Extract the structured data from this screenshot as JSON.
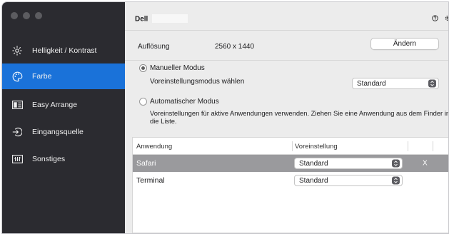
{
  "sidebar": {
    "items": [
      {
        "label": "Helligkeit / Kontrast",
        "icon": "brightness-icon",
        "active": false
      },
      {
        "label": "Farbe",
        "icon": "color-palette-icon",
        "active": true
      },
      {
        "label": "Easy Arrange",
        "icon": "easy-arrange-icon",
        "active": false
      },
      {
        "label": "Eingangsquelle",
        "icon": "input-source-icon",
        "active": false
      },
      {
        "label": "Sonstiges",
        "icon": "others-icon",
        "active": false
      }
    ]
  },
  "header": {
    "title": "Dell",
    "help_icon": "help-icon",
    "settings_icon": "gear-icon"
  },
  "resolution": {
    "label": "Auflösung",
    "value": "2560 x 1440",
    "change_button": "Ändern"
  },
  "manual_mode": {
    "label": "Manueller Modus",
    "selected": true,
    "preset_label": "Voreinstellungsmodus wählen",
    "preset_value": "Standard"
  },
  "auto_mode": {
    "label": "Automatischer Modus",
    "selected": false,
    "description_line1": "Voreinstellungen für aktive Anwendungen verwenden. Ziehen Sie eine Anwendung aus dem Finder in",
    "description_line2": "die Liste."
  },
  "app_table": {
    "columns": [
      "Anwendung",
      "Voreinstellung"
    ],
    "rows": [
      {
        "app": "Safari",
        "preset": "Standard",
        "selected": true,
        "remove": "X"
      },
      {
        "app": "Terminal",
        "preset": "Standard",
        "selected": false,
        "remove": ""
      }
    ]
  },
  "colors": {
    "sidebar_bg": "#2b2b30",
    "accent": "#1a72d9",
    "selected_row": "#9a9a9d"
  }
}
